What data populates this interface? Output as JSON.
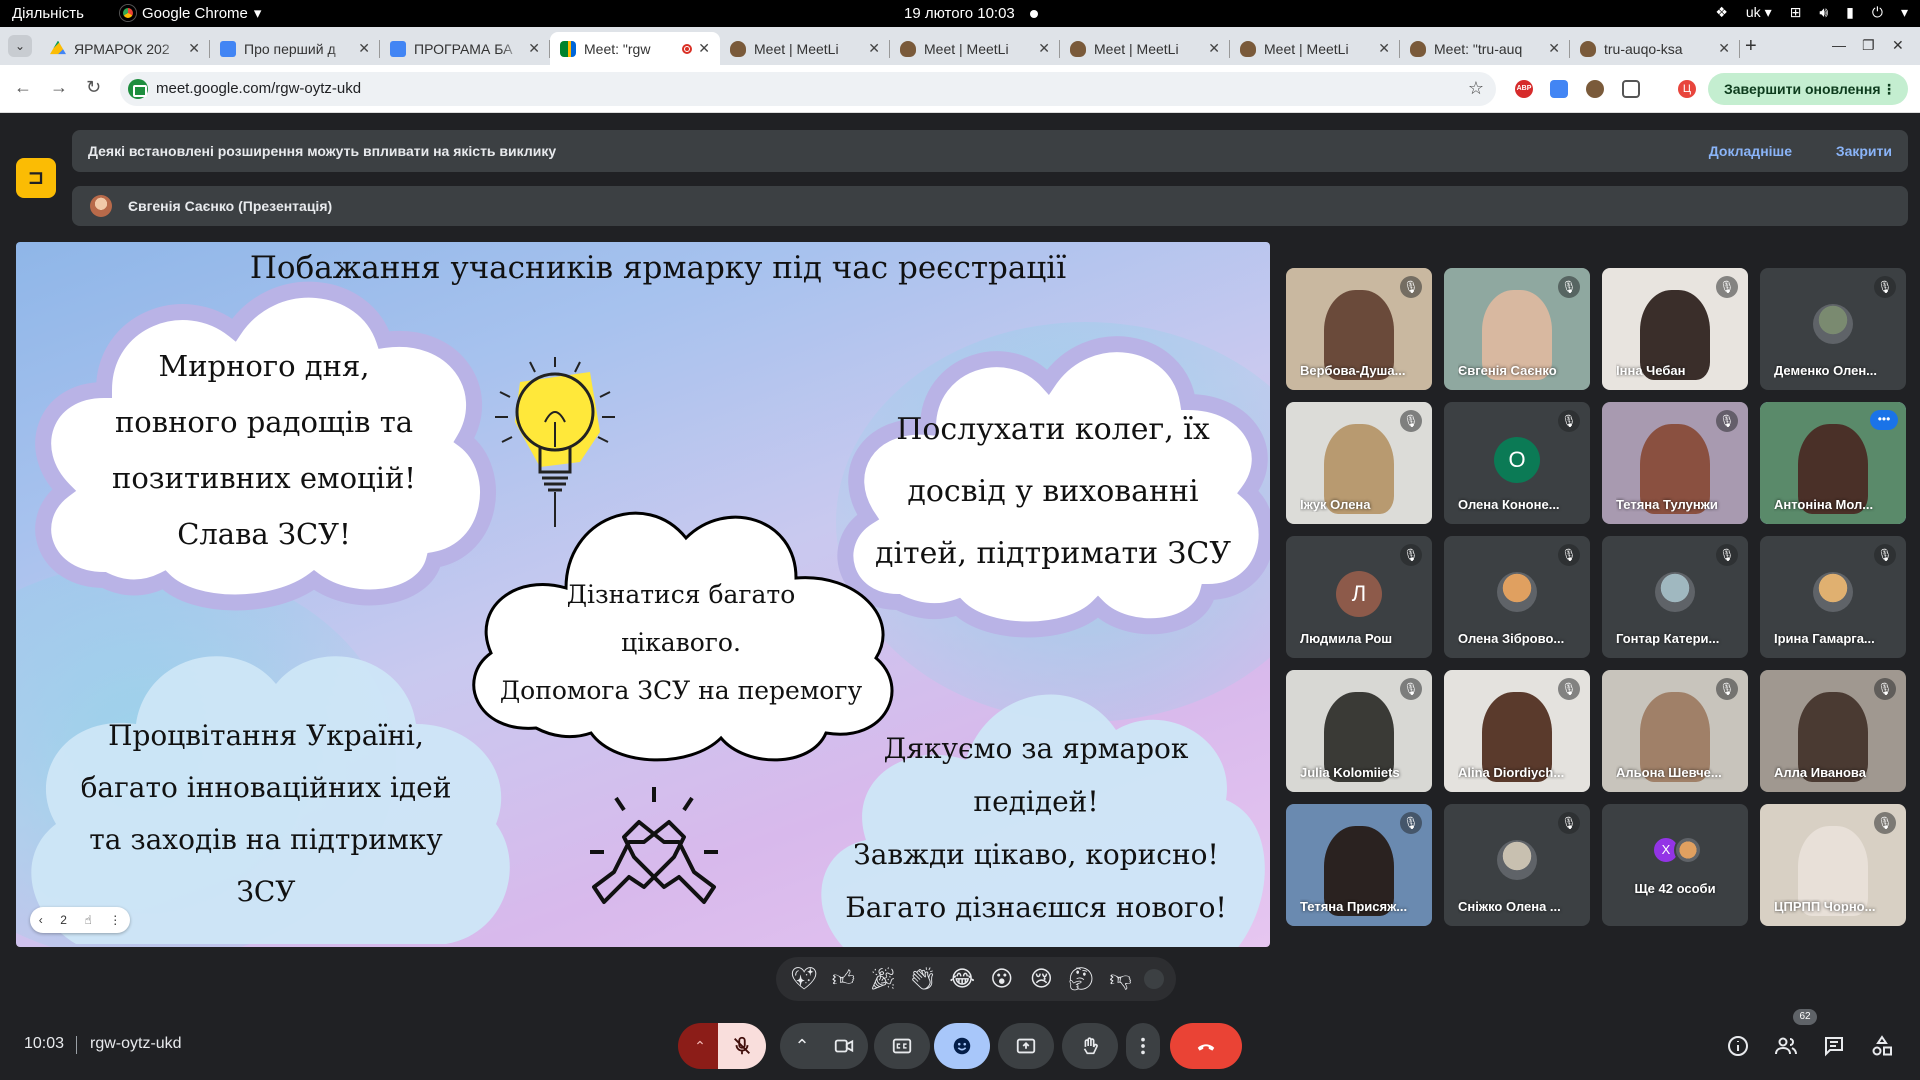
{
  "os": {
    "activities": "Діяльність",
    "app_name": "Google Chrome",
    "clock": "19 лютого  10:03",
    "lang": "uk"
  },
  "tabs": [
    {
      "label": "ЯРМАРОК 202",
      "icon": "drive-icon"
    },
    {
      "label": "Про перший д",
      "icon": "docs-icon"
    },
    {
      "label": "ПРОГРАМА БА",
      "icon": "docs-icon"
    },
    {
      "label": "Meet: \"rgw",
      "icon": "meet-icon",
      "active": true
    },
    {
      "label": "Meet | MeetLi",
      "icon": "owl-icon"
    },
    {
      "label": "Meet | MeetLi",
      "icon": "owl-icon"
    },
    {
      "label": "Meet | MeetLi",
      "icon": "owl-icon"
    },
    {
      "label": "Meet | MeetLi",
      "icon": "owl-icon"
    },
    {
      "label": "Meet: \"tru-auq",
      "icon": "owl-icon"
    },
    {
      "label": "tru-auqo-ksa",
      "icon": "owl-icon"
    }
  ],
  "toolbar": {
    "url": "meet.google.com/rgw-oytz-ukd",
    "update_label": "Завершити оновлення",
    "profile_letter": "Ц",
    "abp": "ABP"
  },
  "meet": {
    "notice": "Деякі встановлені розширення можуть впливати на якість виклику",
    "notice_more": "Докладніше",
    "notice_close": "Закрити",
    "presenter": "Євгенія Саєнко (Презентація)",
    "time": "10:03",
    "code": "rgw-oytz-ukd",
    "participants_count": "62"
  },
  "slide": {
    "title": "Побажання учасників ярмарку під час реєстрації",
    "page": "2",
    "clouds": {
      "c1": [
        "Мирного дня,",
        "повного радощів та",
        "позитивних емоцій!",
        "Слава ЗСУ!"
      ],
      "c2": [
        "Послухати колег, їх",
        "досвід у вихованні",
        "дітей, підтримати ЗСУ"
      ],
      "c3": [
        "Дізнатися багато",
        "цікавого.",
        "Допомога ЗСУ на перемогу"
      ],
      "c4": [
        "Процвітання Україні,",
        "багато інноваційних ідей",
        "та заходів на підтримку",
        "ЗСУ"
      ],
      "c5": [
        "Дякуємо за ярмарок",
        "педідей!",
        "Завжди цікаво, корисно!",
        "Багато дізнаєшся нового!"
      ]
    }
  },
  "tiles": [
    {
      "name": "Вербова-Душа...",
      "kind": "video",
      "bg": "#c9b8a0",
      "person": "#6a4a3a"
    },
    {
      "name": "Євгенія Саєнко",
      "kind": "video",
      "bg": "#8fa8a0",
      "person": "#d8b8a0"
    },
    {
      "name": "Інна Чебан",
      "kind": "video",
      "bg": "#e8e4df",
      "person": "#3a2e2a"
    },
    {
      "name": "Деменко Олен...",
      "kind": "photo",
      "bg": "#3c4043",
      "face": "#7a8a70"
    },
    {
      "name": "Іжук Олена",
      "kind": "video",
      "bg": "#dcdcd8",
      "person": "#b89a70"
    },
    {
      "name": "Олена Кононе...",
      "kind": "letter",
      "letter": "О",
      "color": "#0b7a55"
    },
    {
      "name": "Тетяна Тулунжи",
      "kind": "video",
      "bg": "#a89ab0",
      "person": "#8a5040"
    },
    {
      "name": "Антоніна Мол...",
      "kind": "video",
      "bg": "#5a8a6a",
      "person": "#4a3028",
      "active": true
    },
    {
      "name": "Людмила Рош",
      "kind": "letter",
      "letter": "Л",
      "color": "#8d5a4a"
    },
    {
      "name": "Олена Зіброво...",
      "kind": "photo",
      "bg": "#3c4043",
      "face": "#e0a060"
    },
    {
      "name": "Гонтар Катери...",
      "kind": "photo",
      "bg": "#3c4043",
      "face": "#a0b8c0"
    },
    {
      "name": "Ірина Гамарга...",
      "kind": "photo",
      "bg": "#3c4043",
      "face": "#e0b070"
    },
    {
      "name": "Julia Kolomiiets",
      "kind": "video",
      "bg": "#d8d8d4",
      "person": "#3a3a36"
    },
    {
      "name": "Alina Diordiych...",
      "kind": "video",
      "bg": "#e4e2de",
      "person": "#5a3a2c"
    },
    {
      "name": "Альона Шевче...",
      "kind": "video",
      "bg": "#c8c4bc",
      "person": "#a08068"
    },
    {
      "name": "Алла Иванова",
      "kind": "video",
      "bg": "#a09890",
      "person": "#4a3a32"
    },
    {
      "name": "Тетяна Присяж...",
      "kind": "video",
      "bg": "#6a8ab0",
      "person": "#2a2220"
    },
    {
      "name": "Сніжко Олена ...",
      "kind": "photo",
      "bg": "#3c4043",
      "face": "#c8c0b0"
    },
    {
      "name": "Ще 42 особи",
      "kind": "more",
      "stack": [
        "Х",
        ""
      ]
    },
    {
      "name": "ЦПРПП Чорно...",
      "kind": "video",
      "bg": "#d8d0c4",
      "person": "#e8e0d8"
    }
  ]
}
